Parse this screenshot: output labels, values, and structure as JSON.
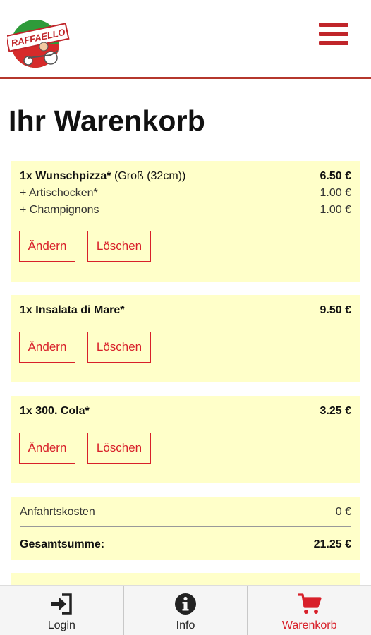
{
  "header": {
    "logo_text": "RAFFAELLO",
    "menu_icon": "hamburger-menu-icon"
  },
  "page_title": "Ihr Warenkorb",
  "cart": {
    "items": [
      {
        "name": "1x Wunschpizza*",
        "variant": "(Groß (32cm))",
        "price": "6.50 €",
        "extras": [
          {
            "name": "+ Artischocken*",
            "price": "1.00 €"
          },
          {
            "name": "+ Champignons",
            "price": "1.00 €"
          }
        ]
      },
      {
        "name": "1x Insalata di Mare*",
        "price": "9.50 €"
      },
      {
        "name": "1x 300. Cola*",
        "price": "3.25 €"
      }
    ],
    "change_label": "Ändern",
    "delete_label": "Löschen"
  },
  "summary": {
    "delivery_label": "Anfahrtskosten",
    "delivery_value": "0 €",
    "total_label": "Gesamtsumme:",
    "total_value": "21.25 €"
  },
  "nav": [
    {
      "label": "Login",
      "icon": "login-icon"
    },
    {
      "label": "Info",
      "icon": "info-icon"
    },
    {
      "label": "Warenkorb",
      "icon": "cart-icon",
      "active": true
    }
  ],
  "colors": {
    "accent": "#d8202a",
    "card_bg": "#ffffc9",
    "header_line": "#b5372c"
  }
}
